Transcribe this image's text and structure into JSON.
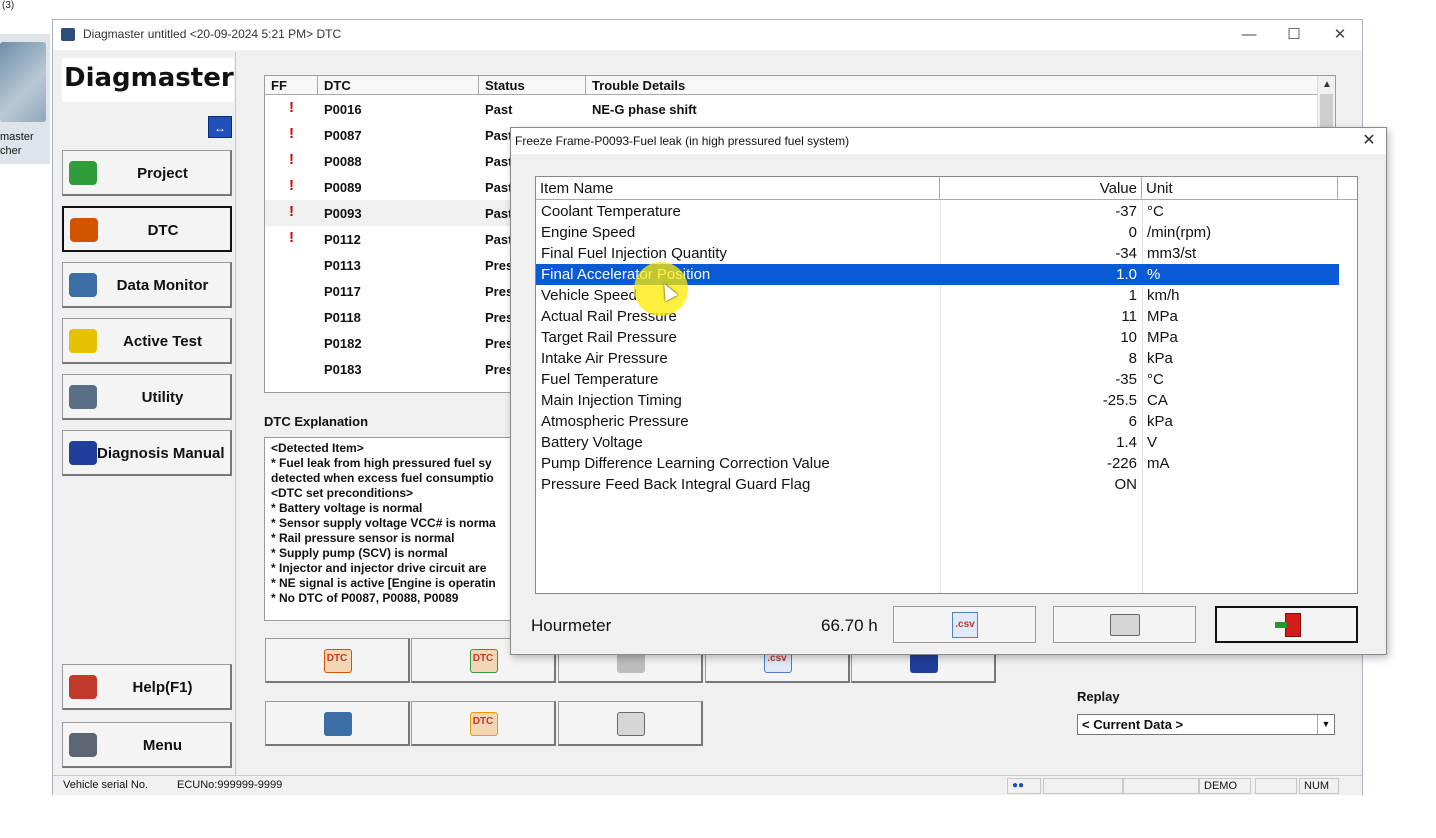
{
  "desktop": {
    "top_text": "(3)",
    "icon_label_line1": "master",
    "icon_label_line2": "cher"
  },
  "window": {
    "title": "Diagmaster untitled <20-09-2024 5:21 PM> DTC",
    "minimize": "—",
    "maximize": "☐",
    "close": "✕"
  },
  "sidebar": {
    "logo": "Diagmaster",
    "swap_icon": "↔",
    "items": [
      {
        "label": "Project",
        "icon": "project-icon",
        "color": "#2e9d3a"
      },
      {
        "label": "DTC",
        "icon": "dtc-icon",
        "color": "#d35400"
      },
      {
        "label": "Data Monitor",
        "icon": "data-monitor-icon",
        "color": "#3a6ea5"
      },
      {
        "label": "Active Test",
        "icon": "active-test-icon",
        "color": "#e6c200"
      },
      {
        "label": "Utility",
        "icon": "utility-icon",
        "color": "#5a6f85"
      },
      {
        "label": "Diagnosis Manual",
        "icon": "book-icon",
        "color": "#1f3f9a"
      },
      {
        "label": "Help(F1)",
        "icon": "help-book-icon",
        "color": "#c0392b"
      },
      {
        "label": "Menu",
        "icon": "menu-icon",
        "color": "#5c6673"
      }
    ]
  },
  "dtc_table": {
    "headers": [
      "FF",
      "DTC",
      "Status",
      "Trouble Details"
    ],
    "rows": [
      {
        "ff": "!",
        "dtc": "P0016",
        "status": "Past",
        "details": "NE-G phase shift"
      },
      {
        "ff": "!",
        "dtc": "P0087",
        "status": "Past",
        "details": ""
      },
      {
        "ff": "!",
        "dtc": "P0088",
        "status": "Past",
        "details": ""
      },
      {
        "ff": "!",
        "dtc": "P0089",
        "status": "Past",
        "details": ""
      },
      {
        "ff": "!",
        "dtc": "P0093",
        "status": "Past",
        "details": ""
      },
      {
        "ff": "!",
        "dtc": "P0112",
        "status": "Past",
        "details": ""
      },
      {
        "ff": "",
        "dtc": "P0113",
        "status": "Pres",
        "details": ""
      },
      {
        "ff": "",
        "dtc": "P0117",
        "status": "Pres",
        "details": ""
      },
      {
        "ff": "",
        "dtc": "P0118",
        "status": "Pres",
        "details": ""
      },
      {
        "ff": "",
        "dtc": "P0182",
        "status": "Pres",
        "details": ""
      },
      {
        "ff": "",
        "dtc": "P0183",
        "status": "Pres",
        "details": ""
      }
    ]
  },
  "dtc_explanation": {
    "label": "DTC Explanation",
    "lines": [
      "<Detected Item>",
      "* Fuel leak from high pressured fuel sy",
      "detected when excess fuel consumptio",
      "<DTC set preconditions>",
      "* Battery voltage is normal",
      "* Sensor supply voltage VCC# is norma",
      "* Rail pressure sensor is normal",
      "* Supply pump (SCV) is normal",
      "* Injector and injector drive circuit are",
      "* NE signal is active [Engine is operatin",
      "* No DTC of P0087, P0088, P0089"
    ]
  },
  "action_buttons": {
    "row1": [
      {
        "icon": "dtc-read-icon",
        "text": "DTC"
      },
      {
        "icon": "dtc-refresh-icon",
        "text": "DTC"
      },
      {
        "icon": "freeze-frame-icon",
        "text": ""
      },
      {
        "icon": "csv-icon",
        "text": ".csv"
      },
      {
        "icon": "manual-icon",
        "text": ""
      }
    ],
    "row2": [
      {
        "icon": "dtc-clear-icon",
        "text": ""
      },
      {
        "icon": "dtc-save-icon",
        "text": "DTC"
      },
      {
        "icon": "printer-icon",
        "text": ""
      }
    ]
  },
  "replay": {
    "label": "Replay",
    "value": "< Current Data >"
  },
  "statusbar": {
    "serial": "Vehicle serial No.",
    "ecu": "ECUNo:999999-9999",
    "mode": "DEMO",
    "num": "NUM"
  },
  "freeze_frame": {
    "title": "Freeze Frame-P0093-Fuel leak (in high pressured fuel system)",
    "close": "✕",
    "headers": [
      "Item Name",
      "Value",
      "Unit"
    ],
    "rows": [
      {
        "name": "Coolant Temperature",
        "value": "-37",
        "unit": "°C"
      },
      {
        "name": "Engine  Speed",
        "value": "0",
        "unit": "/min(rpm)"
      },
      {
        "name": "Final Fuel Injection Quantity",
        "value": "-34",
        "unit": "mm3/st"
      },
      {
        "name": "Final Accelerator Position",
        "value": "1.0",
        "unit": "%"
      },
      {
        "name": "Vehicle Speed",
        "value": "1",
        "unit": "km/h"
      },
      {
        "name": "Actual Rail Pressure",
        "value": "11",
        "unit": "MPa"
      },
      {
        "name": "Target Rail Pressure",
        "value": "10",
        "unit": "MPa"
      },
      {
        "name": "Intake Air Pressure",
        "value": "8",
        "unit": "kPa"
      },
      {
        "name": "Fuel Temperature",
        "value": "-35",
        "unit": "°C"
      },
      {
        "name": "Main Injection Timing",
        "value": "-25.5",
        "unit": "CA"
      },
      {
        "name": "Atmospheric Pressure",
        "value": "6",
        "unit": "kPa"
      },
      {
        "name": "Battery Voltage",
        "value": "1.4",
        "unit": "V"
      },
      {
        "name": "Pump Difference Learning Correction Value",
        "value": "-226",
        "unit": "mA"
      },
      {
        "name": "Pressure Feed Back Integral Guard Flag",
        "value": "ON",
        "unit": ""
      }
    ],
    "selected_index": 3,
    "hourmeter_label": "Hourmeter",
    "hourmeter_value": "66.70 h",
    "csv_label": ".csv"
  }
}
